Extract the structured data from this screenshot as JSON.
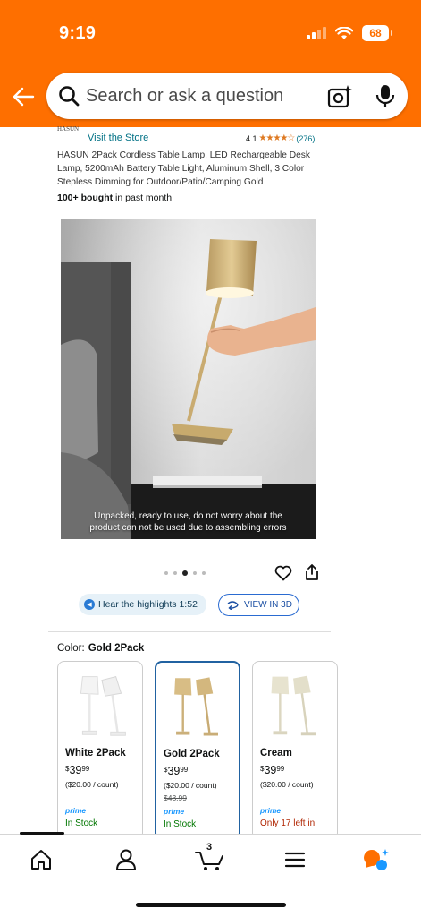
{
  "status_bar": {
    "time": "9:19",
    "battery": "68"
  },
  "search": {
    "placeholder": "Search or ask a question"
  },
  "store": {
    "logo_text": "HASUN",
    "visit_label": "Visit the Store"
  },
  "rating": {
    "value": "4.1",
    "stars": "★★★★☆",
    "count": "(276)"
  },
  "product": {
    "title": "HASUN 2Pack Cordless Table Lamp, LED Rechargeable Desk Lamp, 5200mAh Battery Table Light, Aluminum Shell, 3 Color Stepless Dimming for Outdoor/Patio/Camping Gold",
    "bought_strong": "100+ bought",
    "bought_rest": " in past month",
    "image_caption_line1": "Unpacked, ready to use, do not worry about the",
    "image_caption_line2": "product can not be used due to assembling errors"
  },
  "carousel": {
    "dot_count": 5,
    "active_index": 2
  },
  "actions": {
    "highlights_label": "Hear the highlights 1:52",
    "view3d_label": "VIEW IN 3D"
  },
  "color": {
    "label": "Color:",
    "selected": "Gold 2Pack"
  },
  "swatches": [
    {
      "name": "White 2Pack",
      "symbol": "$",
      "dollars": "39",
      "cents": "99",
      "unit": "($20.00 / count)",
      "list_price": "",
      "prime": "prime",
      "stock": "In Stock",
      "lamp_color": "#f2f2f2"
    },
    {
      "name": "Gold 2Pack",
      "symbol": "$",
      "dollars": "39",
      "cents": "99",
      "unit": "($20.00 / count)",
      "list_price": "$43.99",
      "prime": "prime",
      "stock": "In Stock",
      "lamp_color": "#d8bd85"
    },
    {
      "name": "Cream",
      "symbol": "$",
      "dollars": "39",
      "cents": "99",
      "unit": "($20.00 / count)",
      "list_price": "",
      "prime": "prime",
      "stock": "Only 17 left in",
      "lamp_color": "#e7e3cf"
    }
  ],
  "nav": {
    "cart_count": "3"
  },
  "colors": {
    "header": "#fe6f00",
    "link": "#007185",
    "star": "#de7921",
    "in_stock": "#007600",
    "low_stock": "#b12704",
    "prime": "#1a98ff",
    "selected_border": "#2162a1"
  }
}
